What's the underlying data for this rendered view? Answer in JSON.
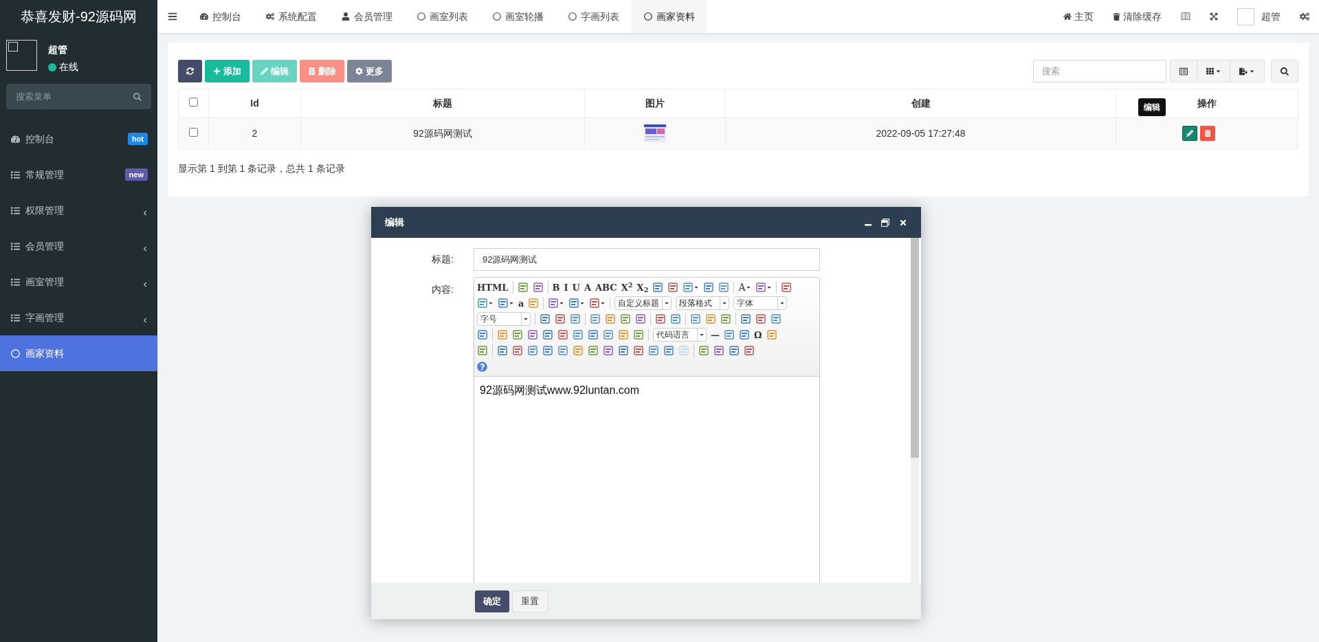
{
  "brand": "恭喜发财-92源码网",
  "user": {
    "name": "超管",
    "status": "在线",
    "online": true
  },
  "sidebar": {
    "search_placeholder": "搜索菜单",
    "items": [
      {
        "kind": "gauge",
        "label": "控制台",
        "badge": "hot",
        "color": "#1e88e5",
        "has_submenu": false,
        "selected": false
      },
      {
        "kind": "list",
        "label": "常规管理",
        "badge": "new",
        "color": "#605ca8",
        "has_submenu": false,
        "selected": false
      },
      {
        "kind": "list",
        "label": "权限管理",
        "has_submenu": true,
        "selected": false
      },
      {
        "kind": "list",
        "label": "会员管理",
        "has_submenu": true,
        "selected": false
      },
      {
        "kind": "list",
        "label": "画室管理",
        "has_submenu": true,
        "selected": false
      },
      {
        "kind": "list",
        "label": "字画管理",
        "has_submenu": true,
        "selected": false
      },
      {
        "kind": "circle",
        "label": "画家资料",
        "has_submenu": false,
        "selected": true
      }
    ]
  },
  "tabs": [
    {
      "kind": "gauge",
      "label": "控制台",
      "selected": false
    },
    {
      "kind": "gears",
      "label": "系统配置",
      "selected": false
    },
    {
      "kind": "user",
      "label": "会员管理",
      "selected": false
    },
    {
      "kind": "circle",
      "label": "画室列表",
      "selected": false
    },
    {
      "kind": "circle",
      "label": "画室轮播",
      "selected": false
    },
    {
      "kind": "circle",
      "label": "字画列表",
      "selected": false
    },
    {
      "kind": "circle",
      "label": "画家资料",
      "selected": true
    }
  ],
  "top_right": {
    "home": "主页",
    "clear_cache": "清除缓存",
    "user": "超管"
  },
  "toolbar": [
    {
      "kind": "refresh",
      "disabled": false
    },
    {
      "kind": "add",
      "label": "添加",
      "disabled": false
    },
    {
      "kind": "edit",
      "label": "编辑",
      "disabled": true
    },
    {
      "kind": "delete",
      "label": "删除",
      "disabled": true
    },
    {
      "kind": "more",
      "label": "更多",
      "disabled": false
    }
  ],
  "table_search": {
    "placeholder": "搜索"
  },
  "table": {
    "columns": [
      "Id",
      "标题",
      "图片",
      "创建",
      "操作"
    ],
    "all_checked": false,
    "rows": [
      {
        "checked": false,
        "id": "2",
        "title": "92源码网测试",
        "created": "2022-09-05 17:27:48"
      }
    ]
  },
  "tooltip": "编辑",
  "pagination": "显示第 1 到第 1 条记录，总共 1 条记录",
  "dialog": {
    "title": "编辑",
    "fields": [
      {
        "label": "标题:",
        "value": "92源码网测试"
      }
    ],
    "content_label": "内容:",
    "editor_toolbar": [
      [
        {
          "kind": "text",
          "label": "HTML"
        },
        {
          "kind": "sep"
        },
        {
          "kind": "icon"
        },
        {
          "kind": "icon"
        },
        {
          "kind": "sep"
        },
        {
          "kind": "text",
          "label": "B"
        },
        {
          "kind": "text",
          "label": "I"
        },
        {
          "kind": "text",
          "label": "U"
        },
        {
          "kind": "text",
          "label": "A"
        },
        {
          "kind": "text",
          "label": "ABC"
        },
        {
          "kind": "text",
          "label": "X$^{2}$"
        },
        {
          "kind": "text",
          "label": "X$_{2}$"
        },
        {
          "kind": "icon"
        },
        {
          "kind": "icon"
        },
        {
          "kind": "drop"
        },
        {
          "kind": "icon"
        },
        {
          "kind": "icon"
        },
        {
          "kind": "sep"
        },
        {
          "kind": "textdrop",
          "label": "A"
        },
        {
          "kind": "drop"
        },
        {
          "kind": "sep"
        },
        {
          "kind": "icon"
        }
      ],
      [
        {
          "kind": "drop"
        },
        {
          "kind": "drop"
        },
        {
          "kind": "text",
          "label": "a"
        },
        {
          "kind": "icon"
        },
        {
          "kind": "sep"
        },
        {
          "kind": "drop"
        },
        {
          "kind": "drop"
        },
        {
          "kind": "drop"
        },
        {
          "kind": "sep"
        },
        {
          "kind": "select",
          "label": "自定义标题"
        },
        {
          "kind": "select",
          "label": "段落格式"
        },
        {
          "kind": "select",
          "label": "字体"
        }
      ],
      [
        {
          "kind": "select",
          "label": "字号"
        },
        {
          "kind": "sep"
        },
        {
          "kind": "icon"
        },
        {
          "kind": "icon"
        },
        {
          "kind": "icon"
        },
        {
          "kind": "sep"
        },
        {
          "kind": "icon"
        },
        {
          "kind": "icon"
        },
        {
          "kind": "icon"
        },
        {
          "kind": "icon"
        },
        {
          "kind": "sep"
        },
        {
          "kind": "icon"
        },
        {
          "kind": "icon"
        },
        {
          "kind": "sep"
        },
        {
          "kind": "icon"
        },
        {
          "kind": "icon"
        },
        {
          "kind": "icon"
        },
        {
          "kind": "sep"
        },
        {
          "kind": "icon"
        },
        {
          "kind": "icon"
        },
        {
          "kind": "icon"
        }
      ],
      [
        {
          "kind": "icon"
        },
        {
          "kind": "sep"
        },
        {
          "kind": "icon"
        },
        {
          "kind": "icon"
        },
        {
          "kind": "icon"
        },
        {
          "kind": "icon"
        },
        {
          "kind": "icon"
        },
        {
          "kind": "icon"
        },
        {
          "kind": "icon"
        },
        {
          "kind": "icon"
        },
        {
          "kind": "icon"
        },
        {
          "kind": "icon"
        },
        {
          "kind": "sep"
        },
        {
          "kind": "select",
          "label": "代码语言"
        },
        {
          "kind": "text",
          "label": "—"
        },
        {
          "kind": "icon"
        },
        {
          "kind": "icon"
        },
        {
          "kind": "text",
          "label": "Ω"
        },
        {
          "kind": "icon"
        }
      ],
      [
        {
          "kind": "icon"
        },
        {
          "kind": "sep"
        },
        {
          "kind": "icon"
        },
        {
          "kind": "icon"
        },
        {
          "kind": "icon"
        },
        {
          "kind": "icon"
        },
        {
          "kind": "icon"
        },
        {
          "kind": "icon"
        },
        {
          "kind": "icon"
        },
        {
          "kind": "icon"
        },
        {
          "kind": "icon"
        },
        {
          "kind": "icon"
        },
        {
          "kind": "icon"
        },
        {
          "kind": "icon"
        },
        {
          "kind": "faded"
        },
        {
          "kind": "sep"
        },
        {
          "kind": "icon"
        },
        {
          "kind": "icon"
        },
        {
          "kind": "icon"
        },
        {
          "kind": "icon"
        }
      ],
      [
        {
          "kind": "help"
        }
      ]
    ],
    "content": "92源码网测试www.92luntan.com",
    "buttons": [
      {
        "kind": "primary",
        "label": "确定"
      },
      {
        "kind": "plain",
        "label": "重置"
      }
    ]
  }
}
